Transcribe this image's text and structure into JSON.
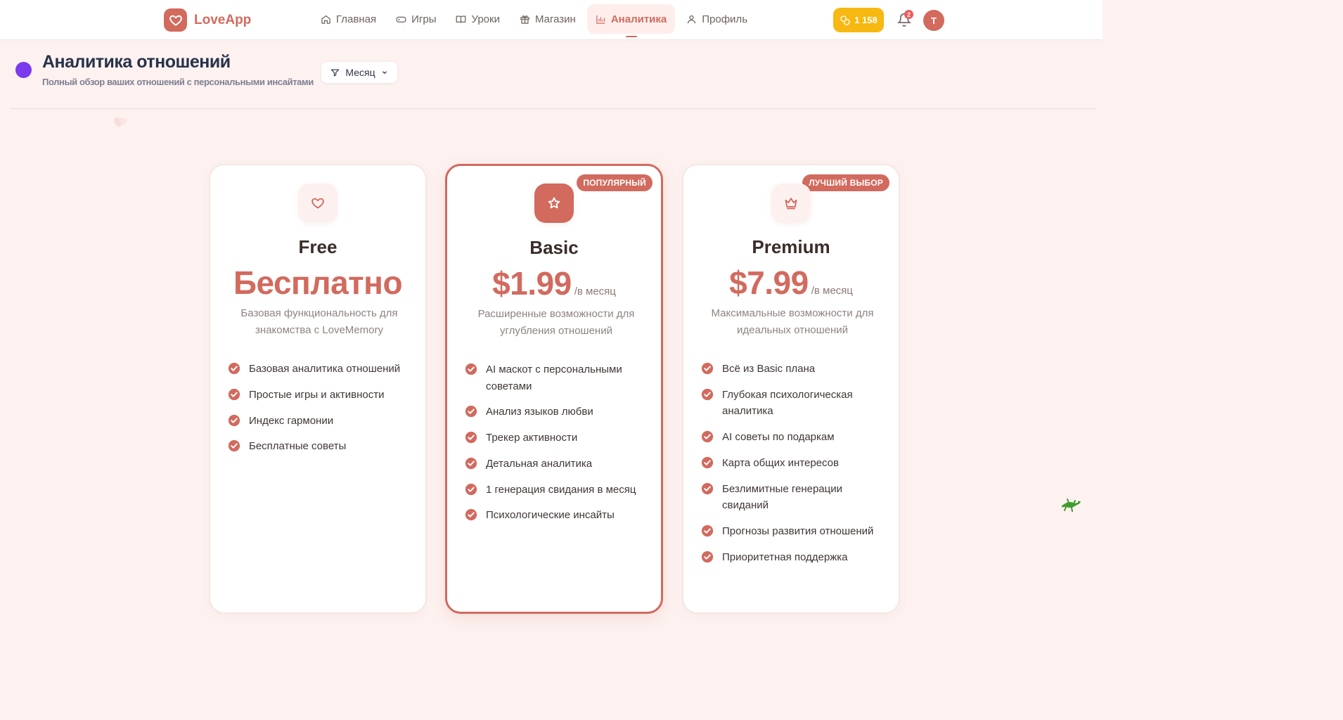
{
  "app": {
    "name": "LoveApp"
  },
  "nav": {
    "items": [
      {
        "label": "Главная",
        "icon": "home-icon",
        "active": false
      },
      {
        "label": "Игры",
        "icon": "gamepad-icon",
        "active": false
      },
      {
        "label": "Уроки",
        "icon": "book-icon",
        "active": false
      },
      {
        "label": "Магазин",
        "icon": "gift-icon",
        "active": false
      },
      {
        "label": "Аналитика",
        "icon": "bar-chart-icon",
        "active": true
      },
      {
        "label": "Профиль",
        "icon": "user-icon",
        "active": false
      }
    ]
  },
  "header": {
    "coins": "1 158",
    "notifications": "2",
    "avatar_initial": "T"
  },
  "page": {
    "title": "Аналитика отношений",
    "subtitle": "Полный обзор ваших отношений с персональными инсайтами",
    "filter_label": "Месяц"
  },
  "plans": [
    {
      "name": "Free",
      "price": "Бесплатно",
      "period": "",
      "badge": "",
      "icon": "heart-icon",
      "description": "Базовая функциональность для знакомства с LoveMemory",
      "features": [
        "Базовая аналитика отношений",
        "Простые игры и активности",
        "Индекс гармонии",
        "Бесплатные советы"
      ]
    },
    {
      "name": "Basic",
      "price": "$1.99",
      "period": "/в месяц",
      "badge": "ПОПУЛЯРНЫЙ",
      "icon": "star-icon",
      "description": "Расширенные возможности для углубления отношений",
      "features": [
        "AI маскот с персональными советами",
        "Анализ языков любви",
        "Трекер активности",
        "Детальная аналитика",
        "1 генерация свидания в месяц",
        "Психологические инсайты"
      ]
    },
    {
      "name": "Premium",
      "price": "$7.99",
      "period": "/в месяц",
      "badge": "ЛУЧШИЙ ВЫБОР",
      "icon": "crown-icon",
      "description": "Максимальные возможности для идеальных отношений",
      "features": [
        "Всё из Basic плана",
        "Глубокая психологическая аналитика",
        "AI советы по подаркам",
        "Карта общих интересов",
        "Безлимитные генерации свиданий",
        "Прогнозы развития отношений",
        "Приоритетная поддержка"
      ]
    }
  ],
  "colors": {
    "accent": "#d26a5e",
    "coins": "#f7b811",
    "purple": "#7c3aed"
  }
}
